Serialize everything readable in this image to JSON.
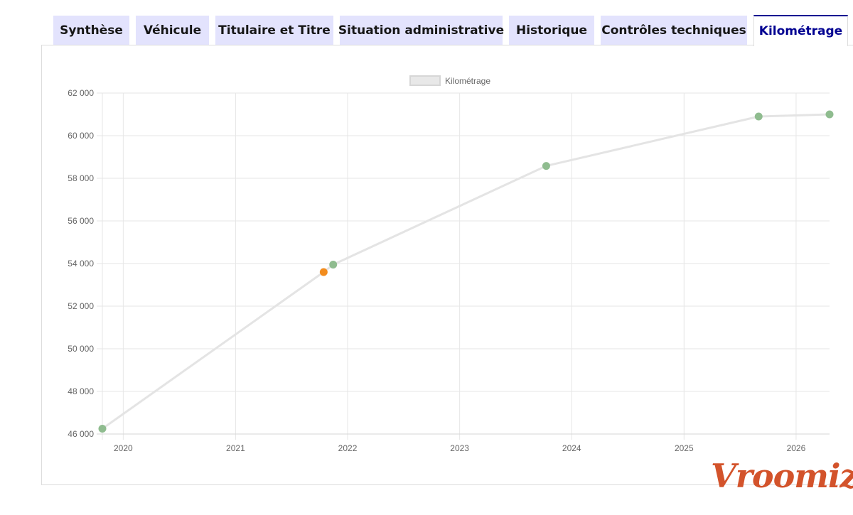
{
  "tabs": [
    {
      "label": "Synthèse",
      "active": false
    },
    {
      "label": "Véhicule",
      "active": false
    },
    {
      "label": "Titulaire et Titre",
      "active": false
    },
    {
      "label": "Situation administrative",
      "active": false
    },
    {
      "label": "Historique",
      "active": false
    },
    {
      "label": "Contrôles techniques",
      "active": false
    },
    {
      "label": "Kilométrage",
      "active": true
    }
  ],
  "colors": {
    "tab_bg": "#e3e3fd",
    "tab_active_text": "#000091",
    "line": "#e4e4e4",
    "point_green": "#8fbc8f",
    "point_orange": "#f28c1e",
    "logo": "#d3532b"
  },
  "logo_text": "Vroomiz",
  "chart_data": {
    "type": "line",
    "legend": {
      "label": "Kilométrage",
      "position": "top-center"
    },
    "grid": true,
    "x_axis": {
      "ticks": [
        "2020",
        "2021",
        "2022",
        "2023",
        "2024",
        "2025",
        "2026"
      ],
      "range": [
        "2019-10-25",
        "2026-04-20"
      ]
    },
    "y_axis": {
      "ticks": [
        "46 000",
        "48 000",
        "50 000",
        "52 000",
        "54 000",
        "56 000",
        "58 000",
        "60 000",
        "62 000"
      ],
      "range": [
        46000,
        62000
      ]
    },
    "series": [
      {
        "name": "Kilométrage",
        "points": [
          {
            "x": "2019-10-25",
            "y": 46250,
            "color": "point_green"
          },
          {
            "x": "2021-10-15",
            "y": 53600,
            "color": "point_orange"
          },
          {
            "x": "2021-11-15",
            "y": 53950,
            "color": "point_green"
          },
          {
            "x": "2023-10-10",
            "y": 58580,
            "color": "point_green"
          },
          {
            "x": "2025-09-01",
            "y": 60900,
            "color": "point_green"
          },
          {
            "x": "2026-04-20",
            "y": 61000,
            "color": "point_green"
          }
        ]
      }
    ]
  }
}
